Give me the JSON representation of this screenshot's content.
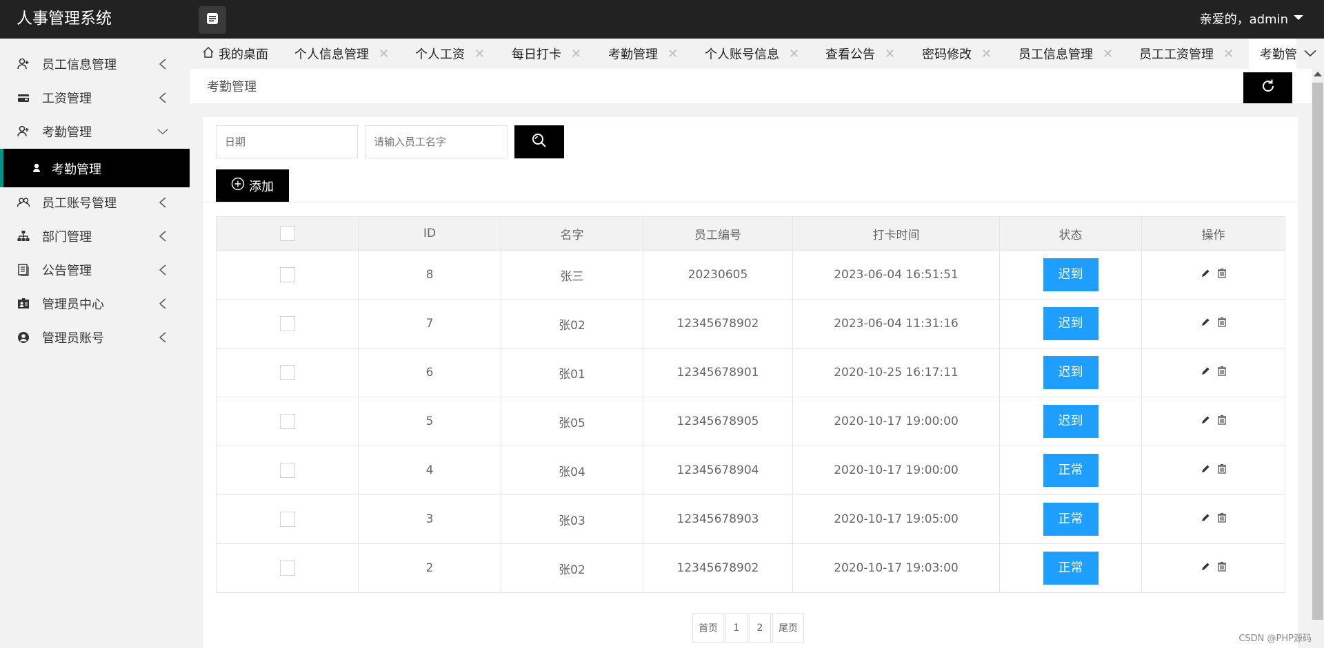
{
  "app": {
    "title": "人事管理系统",
    "user_label": "亲爱的，admin"
  },
  "sidebar": {
    "items": [
      {
        "label": "员工信息管理",
        "icon": "user-add-icon"
      },
      {
        "label": "工资管理",
        "icon": "wallet-icon"
      },
      {
        "label": "考勤管理",
        "icon": "user-add-icon",
        "expanded": true
      },
      {
        "label": "员工账号管理",
        "icon": "users-icon"
      },
      {
        "label": "部门管理",
        "icon": "org-chart-icon"
      },
      {
        "label": "公告管理",
        "icon": "document-icon"
      },
      {
        "label": "管理员中心",
        "icon": "id-card-icon"
      },
      {
        "label": "管理员账号",
        "icon": "user-circle-icon"
      }
    ],
    "sub_item": {
      "label": "考勤管理",
      "icon": "person-icon"
    }
  },
  "tabs": [
    {
      "label": "我的桌面",
      "icon": "home-icon",
      "closable": false
    },
    {
      "label": "个人信息管理",
      "closable": true
    },
    {
      "label": "个人工资",
      "closable": true
    },
    {
      "label": "每日打卡",
      "closable": true
    },
    {
      "label": "考勤管理",
      "closable": true
    },
    {
      "label": "个人账号信息",
      "closable": true
    },
    {
      "label": "查看公告",
      "closable": true
    },
    {
      "label": "密码修改",
      "closable": true
    },
    {
      "label": "员工信息管理",
      "closable": true
    },
    {
      "label": "员工工资管理",
      "closable": true
    },
    {
      "label": "考勤管",
      "closable": false,
      "active": true
    }
  ],
  "breadcrumb": "考勤管理",
  "search": {
    "date_placeholder": "日期",
    "name_placeholder": "请输入员工名字"
  },
  "toolbar": {
    "add_label": "添加"
  },
  "table": {
    "headers": [
      "",
      "ID",
      "名字",
      "员工编号",
      "打卡时间",
      "状态",
      "操作"
    ],
    "rows": [
      {
        "id": "8",
        "name": "张三",
        "emp_no": "20230605",
        "time": "2023-06-04 16:51:51",
        "status": "迟到"
      },
      {
        "id": "7",
        "name": "张02",
        "emp_no": "12345678902",
        "time": "2023-06-04 11:31:16",
        "status": "迟到"
      },
      {
        "id": "6",
        "name": "张01",
        "emp_no": "12345678901",
        "time": "2020-10-25 16:17:11",
        "status": "迟到"
      },
      {
        "id": "5",
        "name": "张05",
        "emp_no": "12345678905",
        "time": "2020-10-17 19:00:00",
        "status": "迟到"
      },
      {
        "id": "4",
        "name": "张04",
        "emp_no": "12345678904",
        "time": "2020-10-17 19:00:00",
        "status": "正常"
      },
      {
        "id": "3",
        "name": "张03",
        "emp_no": "12345678903",
        "time": "2020-10-17 19:05:00",
        "status": "正常"
      },
      {
        "id": "2",
        "name": "张02",
        "emp_no": "12345678902",
        "time": "2020-10-17 19:03:00",
        "status": "正常"
      }
    ]
  },
  "pager": {
    "first": "首页",
    "pages": [
      "1",
      "2"
    ],
    "last": "尾页"
  },
  "watermark": "CSDN @PHP源码",
  "colors": {
    "header": "#222222",
    "accent": "#1e9fff",
    "sidebar_active": "#000000",
    "active_border": "#009688"
  }
}
